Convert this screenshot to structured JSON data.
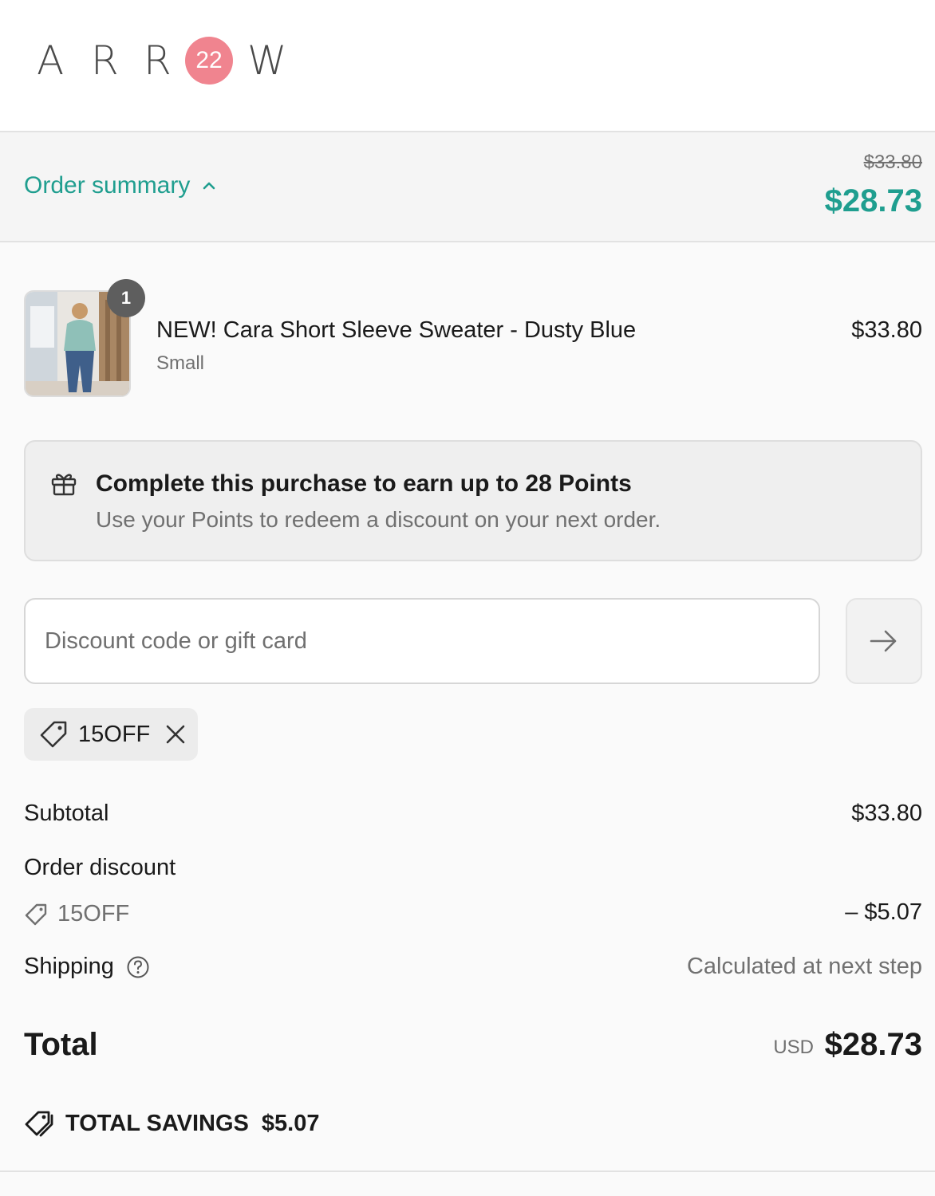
{
  "brand": {
    "letters": [
      "A",
      "R",
      "R",
      "W"
    ],
    "badge": "22",
    "badge_color": "#f0848f"
  },
  "summary": {
    "toggle_label": "Order summary",
    "original_total": "$33.80",
    "discounted_total": "$28.73",
    "accent_color": "#1f9e8f"
  },
  "line_item": {
    "quantity": "1",
    "name": "NEW! Cara Short Sleeve Sweater - Dusty Blue",
    "variant": "Small",
    "price": "$33.80"
  },
  "points": {
    "title": "Complete this purchase to earn up to 28 Points",
    "subtitle": "Use your Points to redeem a discount on your next order."
  },
  "discount": {
    "placeholder": "Discount code or gift card",
    "applied_code": "15OFF"
  },
  "totals": {
    "subtotal_label": "Subtotal",
    "subtotal_value": "$33.80",
    "discount_label": "Order discount",
    "discount_code": "15OFF",
    "discount_value": "– $5.07",
    "shipping_label": "Shipping",
    "shipping_value": "Calculated at next step",
    "total_label": "Total",
    "currency": "USD",
    "total_value": "$28.73",
    "savings_label": "TOTAL SAVINGS",
    "savings_value": "$5.07"
  }
}
